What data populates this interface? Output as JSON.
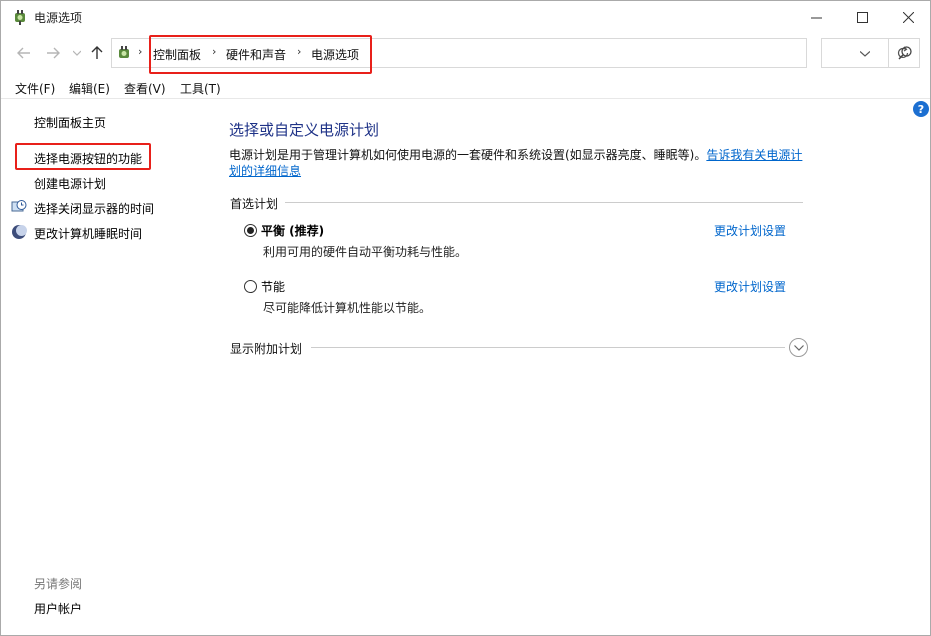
{
  "window": {
    "title": "电源选项"
  },
  "address": {
    "crumbs": [
      "控制面板",
      "硬件和声音",
      "电源选项"
    ],
    "search_placeholder": ""
  },
  "menu": [
    "文件(F)",
    "编辑(E)",
    "查看(V)",
    "工具(T)"
  ],
  "sidebar": {
    "home": "控制面板主页",
    "items": [
      {
        "label": "选择电源按钮的功能",
        "icon": "none"
      },
      {
        "label": "创建电源计划",
        "icon": "none"
      },
      {
        "label": "选择关闭显示器的时间",
        "icon": "clock-monitor-icon"
      },
      {
        "label": "更改计算机睡眠时间",
        "icon": "moon-icon"
      }
    ],
    "see_also_heading": "另请参阅",
    "see_also": [
      "用户帐户"
    ]
  },
  "main": {
    "title": "选择或自定义电源计划",
    "description": "电源计划是用于管理计算机如何使用电源的一套硬件和系统设置(如显示器亮度、睡眠等)。",
    "description_link": "告诉我有关电源计划的详细信息",
    "preferred_heading": "首选计划",
    "plans": [
      {
        "name": "平衡 (推荐)",
        "desc": "利用可用的硬件自动平衡功耗与性能。",
        "link": "更改计划设置",
        "selected": true
      },
      {
        "name": "节能",
        "desc": "尽可能降低计算机性能以节能。",
        "link": "更改计划设置",
        "selected": false
      }
    ],
    "additional_heading": "显示附加计划"
  },
  "colors": {
    "highlight_box": "#e8201a",
    "title_blue": "#1e3287",
    "link_blue": "#0066cc"
  }
}
